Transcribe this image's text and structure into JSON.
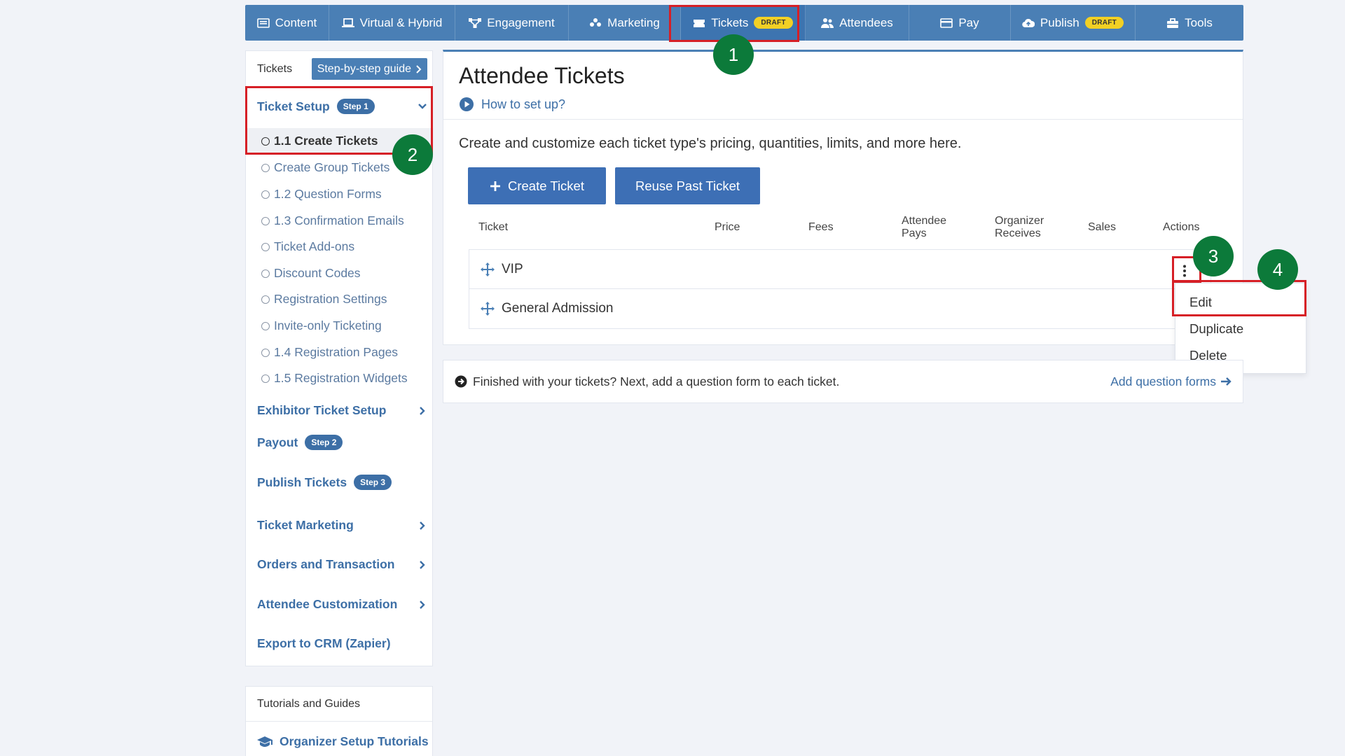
{
  "nav": [
    {
      "label": "Content",
      "icon": "content-icon",
      "badge": ""
    },
    {
      "label": "Virtual & Hybrid",
      "icon": "laptop-icon",
      "badge": ""
    },
    {
      "label": "Engagement",
      "icon": "network-icon",
      "badge": ""
    },
    {
      "label": "Marketing",
      "icon": "group-icon",
      "badge": ""
    },
    {
      "label": "Tickets",
      "icon": "ticket-icon",
      "badge": "DRAFT"
    },
    {
      "label": "Attendees",
      "icon": "users-icon",
      "badge": ""
    },
    {
      "label": "Pay",
      "icon": "card-icon",
      "badge": ""
    },
    {
      "label": "Publish",
      "icon": "cloud-upload-icon",
      "badge": "DRAFT"
    },
    {
      "label": "Tools",
      "icon": "toolbox-icon",
      "badge": ""
    }
  ],
  "sidebar": {
    "header_label": "Tickets",
    "guide_button": "Step-by-step guide",
    "ticket_setup": {
      "label": "Ticket Setup",
      "badge": "Step 1"
    },
    "items": [
      "1.1 Create Tickets",
      "Create Group Tickets",
      "1.2 Question Forms",
      "1.3 Confirmation Emails",
      "Ticket Add-ons",
      "Discount Codes",
      "Registration Settings",
      "Invite-only Ticketing",
      "1.4 Registration Pages",
      "1.5 Registration Widgets"
    ],
    "sections": [
      {
        "label": "Exhibitor Ticket Setup",
        "badge": ""
      },
      {
        "label": "Payout",
        "badge": "Step 2"
      },
      {
        "label": "Publish Tickets",
        "badge": "Step 3"
      },
      {
        "label": "Ticket Marketing",
        "badge": ""
      },
      {
        "label": "Orders and Transaction",
        "badge": ""
      },
      {
        "label": "Attendee Customization",
        "badge": ""
      },
      {
        "label": "Export to CRM (Zapier)",
        "badge": ""
      }
    ]
  },
  "tutorials": {
    "header": "Tutorials and Guides",
    "link": "Organizer Setup Tutorials"
  },
  "main": {
    "title": "Attendee Tickets",
    "how_to": "How to set up?",
    "description": "Create and customize each ticket type's pricing, quantities, limits, and more here.",
    "create_button": "Create Ticket",
    "reuse_button": "Reuse Past Ticket",
    "columns": [
      "Ticket",
      "Price",
      "Fees",
      "Attendee Pays",
      "Organizer Receives",
      "Sales",
      "Actions"
    ],
    "tickets": [
      "VIP",
      "General Admission"
    ]
  },
  "dropdown": [
    "Edit",
    "Duplicate",
    "Delete"
  ],
  "next": {
    "text": "Finished with your tickets? Next, add a question form to each ticket.",
    "link": "Add question forms"
  },
  "markers": [
    "1",
    "2",
    "3",
    "4"
  ],
  "colors": {
    "nav": "#4a7fb5",
    "accent": "#3d6fa6",
    "button": "#3d6fb5",
    "draft": "#f2d024",
    "highlight": "#d61f26",
    "marker": "#0c7a3a"
  }
}
